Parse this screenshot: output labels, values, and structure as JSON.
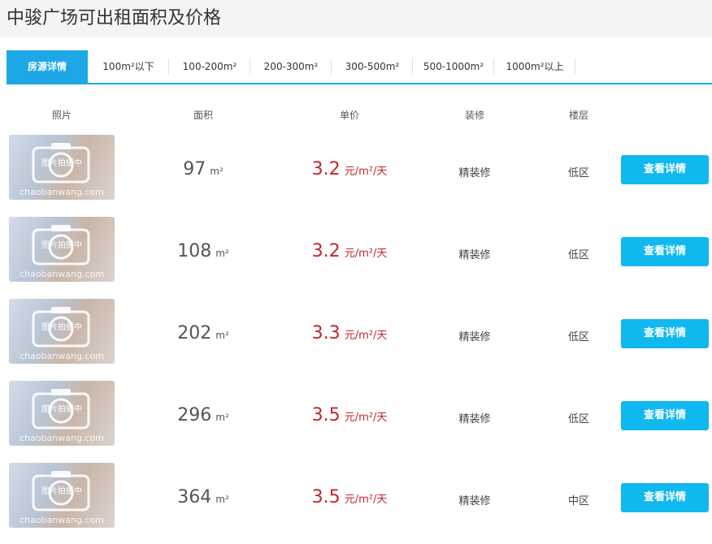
{
  "title": "中骏广场可出租面积及价格",
  "tabs": [
    "房源详情",
    "100m²以下",
    "100-200m²",
    "200-300m²",
    "300-500m²",
    "500-1000m²",
    "1000m²以上"
  ],
  "headers": {
    "photo": "照片",
    "area": "面积",
    "price": "单价",
    "decoration": "装修",
    "floor": "楼层"
  },
  "thumbnail": {
    "watermark_caption": "图片拍摄中",
    "watermark_site": "chaobanwang.com",
    "icon": "camera-icon"
  },
  "units": {
    "area": "m²",
    "price": "元/m²/天"
  },
  "button_label": "查看详情",
  "listings": [
    {
      "area": "97",
      "price": "3.2",
      "decoration": "精装修",
      "floor": "低区"
    },
    {
      "area": "108",
      "price": "3.2",
      "decoration": "精装修",
      "floor": "低区"
    },
    {
      "area": "202",
      "price": "3.3",
      "decoration": "精装修",
      "floor": "低区"
    },
    {
      "area": "296",
      "price": "3.5",
      "decoration": "精装修",
      "floor": "低区"
    },
    {
      "area": "364",
      "price": "3.5",
      "decoration": "精装修",
      "floor": "中区"
    }
  ],
  "colors": {
    "accent": "#1ea7e6",
    "button": "#0fb9ef",
    "price": "#c0272d"
  }
}
